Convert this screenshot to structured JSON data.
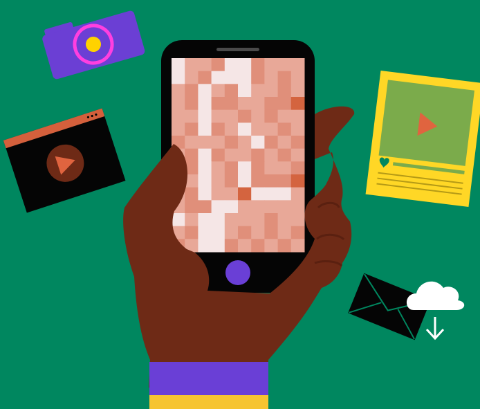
{
  "colors": {
    "background": "#00875f",
    "phone_body": "#050505",
    "speaker": "#4a4a4a",
    "home_button": "#6a3fd6",
    "skin": "#6e2a16",
    "cuff_purple": "#6a3fd6",
    "cuff_yellow": "#f6c431",
    "camera_body": "#6b3fd4",
    "camera_ring": "#ff3fe0",
    "camera_lens": "#ffd200",
    "video_window": "#050505",
    "video_titlebar": "#d4603c",
    "video_play_circle": "#6e2a16",
    "play_arrow": "#e0643f",
    "post_frame": "#ffd726",
    "post_panel": "#7bab4b",
    "heart": "#00875f",
    "envelope": "#050505",
    "envelope_lines": "#00875f",
    "cloud": "#ffffff",
    "pixel_palette": [
      "#f5e6e6",
      "#e8a898",
      "#e08f7a",
      "#d4643f"
    ]
  },
  "icons": {
    "camera": "camera-icon",
    "video": "video-window-icon",
    "post": "social-post-icon",
    "mail": "envelope-icon",
    "download": "cloud-download-icon"
  },
  "screen_pixels": [
    [
      0,
      1,
      1,
      2,
      0,
      0,
      2,
      1,
      1,
      1
    ],
    [
      0,
      1,
      2,
      0,
      0,
      0,
      2,
      1,
      2,
      1
    ],
    [
      1,
      2,
      0,
      1,
      2,
      0,
      1,
      1,
      2,
      1
    ],
    [
      1,
      2,
      0,
      2,
      2,
      1,
      1,
      2,
      2,
      3
    ],
    [
      1,
      1,
      0,
      1,
      1,
      2,
      1,
      2,
      1,
      1
    ],
    [
      1,
      2,
      0,
      2,
      1,
      0,
      1,
      1,
      2,
      1
    ],
    [
      2,
      1,
      1,
      1,
      2,
      1,
      0,
      2,
      1,
      2
    ],
    [
      1,
      2,
      0,
      2,
      1,
      1,
      2,
      1,
      2,
      1
    ],
    [
      2,
      2,
      0,
      1,
      2,
      0,
      2,
      1,
      1,
      2
    ],
    [
      1,
      1,
      0,
      1,
      2,
      0,
      2,
      2,
      2,
      3
    ],
    [
      1,
      2,
      0,
      1,
      1,
      3,
      0,
      0,
      0,
      1
    ],
    [
      1,
      2,
      2,
      0,
      0,
      1,
      1,
      1,
      1,
      1
    ],
    [
      0,
      1,
      0,
      0,
      1,
      1,
      1,
      2,
      1,
      1
    ],
    [
      1,
      2,
      0,
      0,
      1,
      2,
      1,
      2,
      1,
      2
    ],
    [
      2,
      1,
      0,
      0,
      2,
      1,
      2,
      1,
      2,
      1
    ]
  ]
}
